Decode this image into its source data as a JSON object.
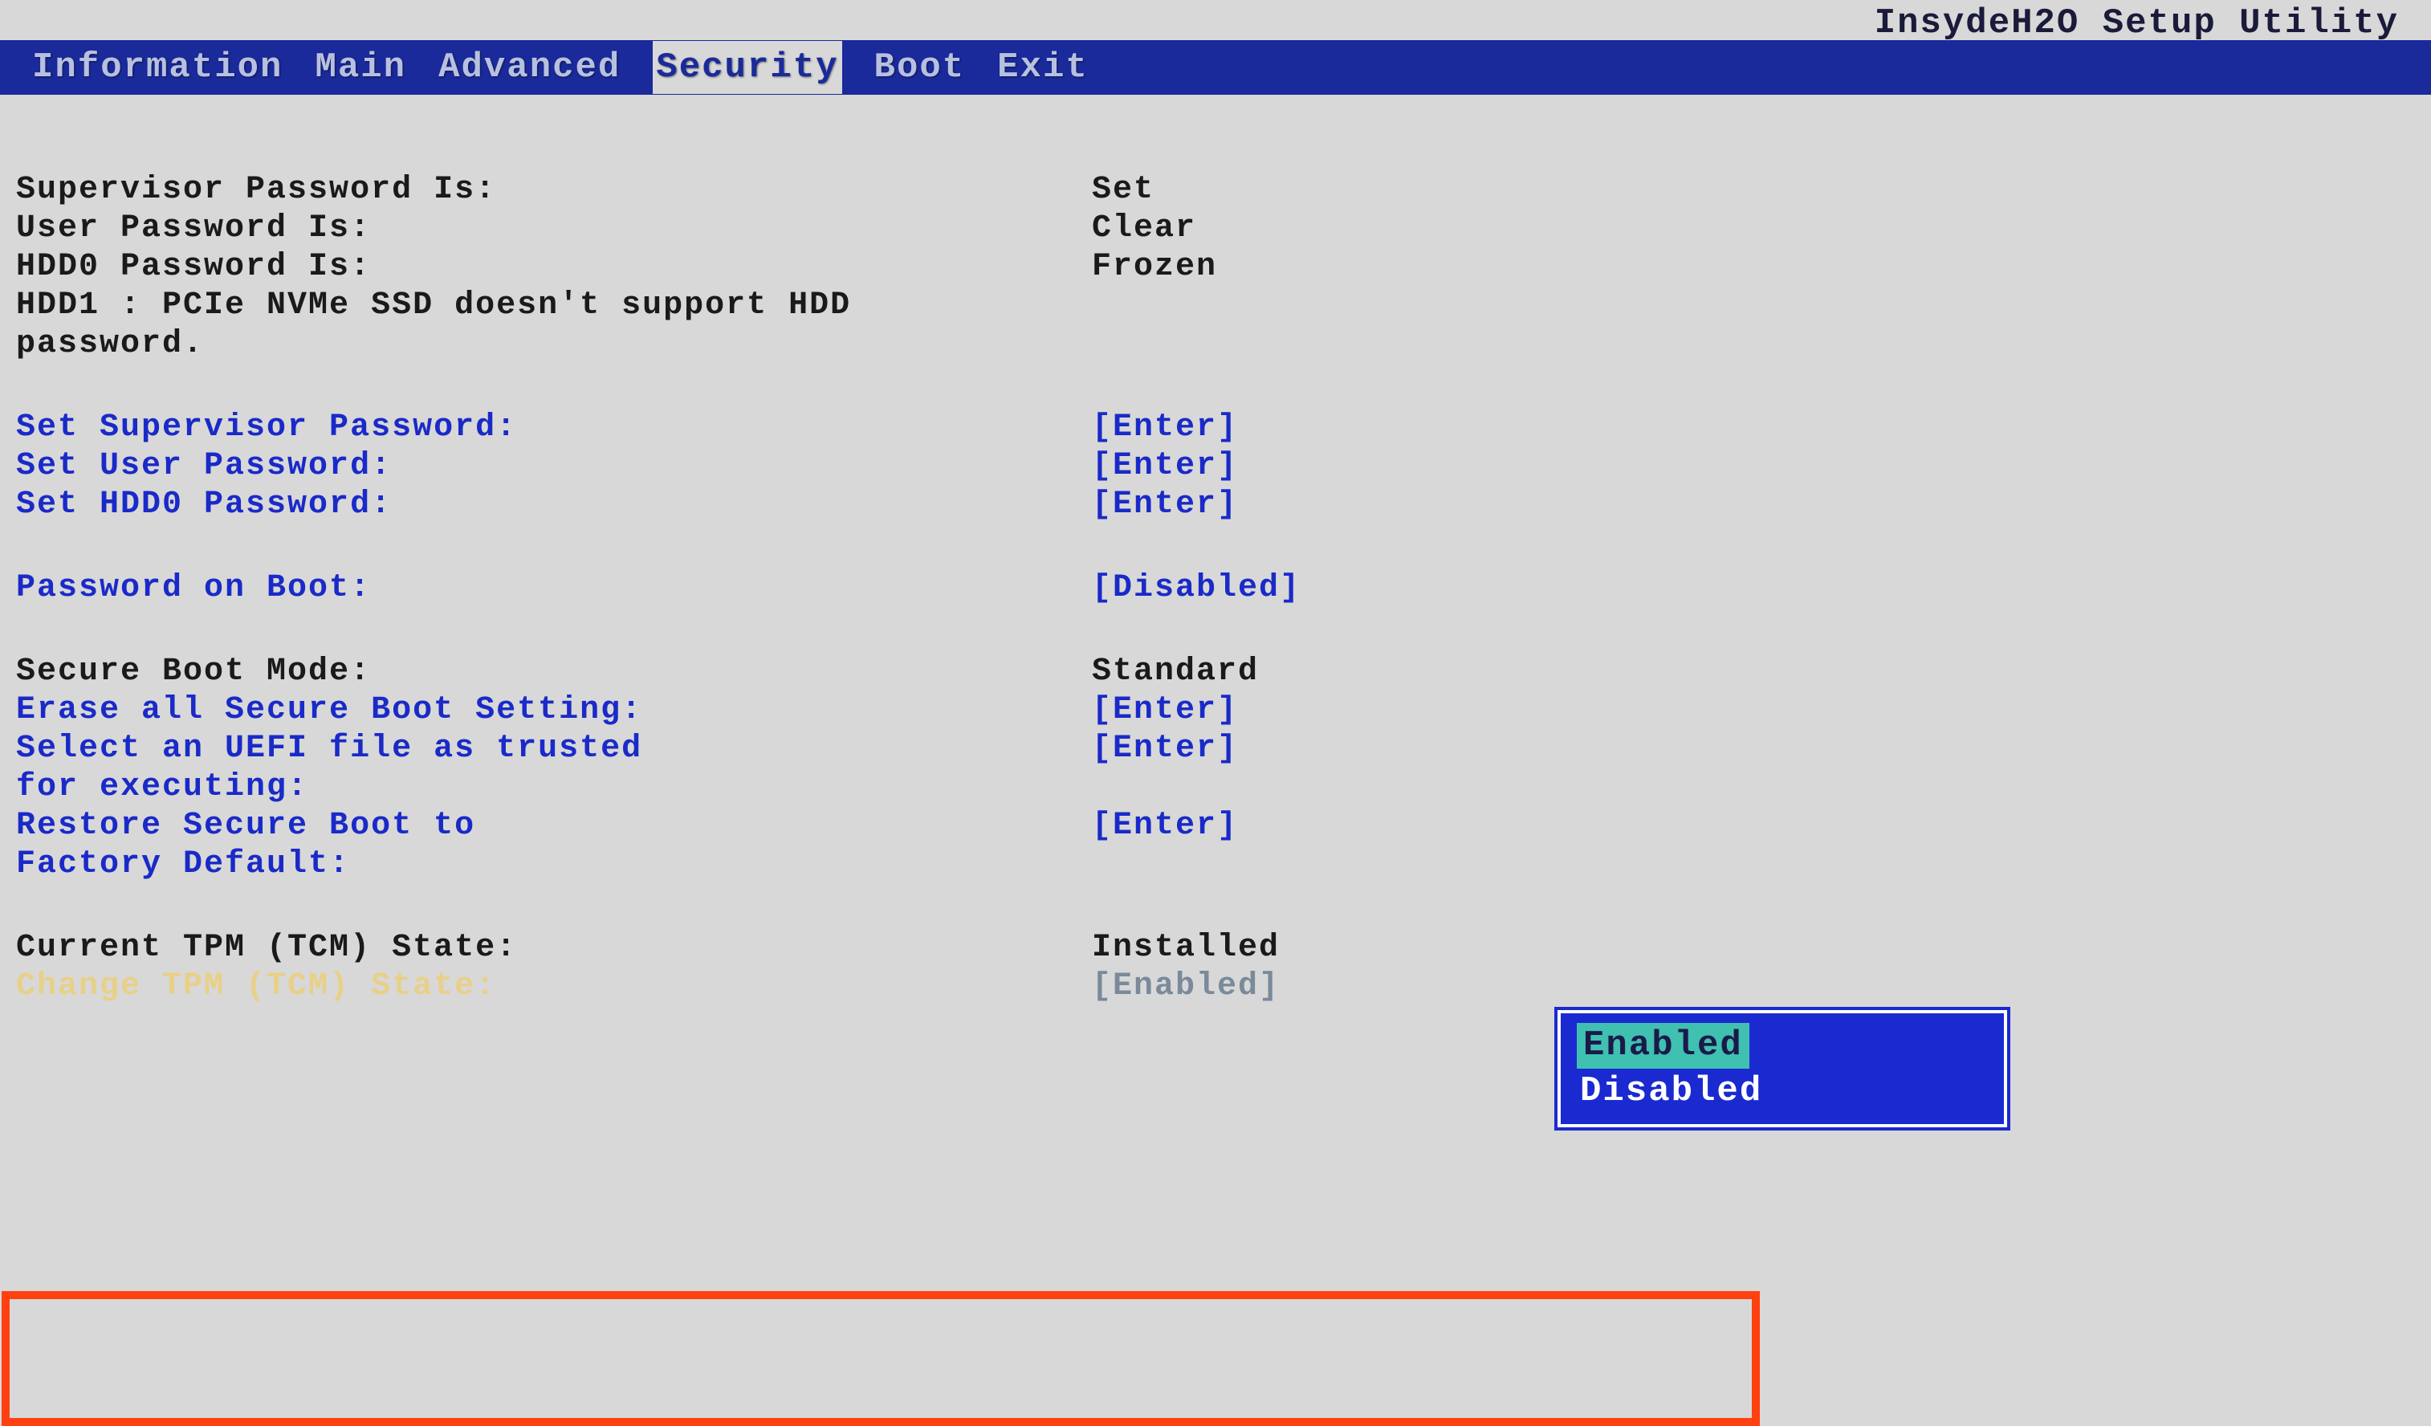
{
  "title": "InsydeH2O Setup Utility",
  "menu": {
    "items": [
      "Information",
      "Main",
      "Advanced",
      "Security",
      "Boot",
      "Exit"
    ],
    "active": "Security"
  },
  "security": {
    "supervisor_password_label": "Supervisor Password Is:",
    "supervisor_password_value": "Set",
    "user_password_label": "User Password Is:",
    "user_password_value": "Clear",
    "hdd0_password_label": "HDD0 Password Is:",
    "hdd0_password_value": "Frozen",
    "hdd1_note_line1": "HDD1 : PCIe NVMe SSD doesn't support HDD",
    "hdd1_note_line2": "password.",
    "set_supervisor_label": "Set Supervisor Password:",
    "set_supervisor_value": "[Enter]",
    "set_user_label": "Set User Password:",
    "set_user_value": "[Enter]",
    "set_hdd0_label": "Set HDD0 Password:",
    "set_hdd0_value": "[Enter]",
    "password_on_boot_label": "Password on Boot:",
    "password_on_boot_value": "[Disabled]",
    "secure_boot_mode_label": "Secure Boot Mode:",
    "secure_boot_mode_value": "Standard",
    "erase_secure_boot_label": "Erase all Secure Boot Setting:",
    "erase_secure_boot_value": "[Enter]",
    "select_uefi_line1": "Select an UEFI file as trusted",
    "select_uefi_line2": "for executing:",
    "select_uefi_value": "[Enter]",
    "restore_secure_boot_line1": "Restore Secure Boot to",
    "restore_secure_boot_line2": "Factory Default:",
    "restore_secure_boot_value": "[Enter]",
    "current_tpm_label": "Current TPM (TCM) State:",
    "current_tpm_value": "Installed",
    "change_tpm_label": "Change TPM (TCM) State:",
    "change_tpm_value": "[Enabled]"
  },
  "popup": {
    "options": [
      "Enabled",
      "Disabled"
    ],
    "selected": "Enabled"
  }
}
